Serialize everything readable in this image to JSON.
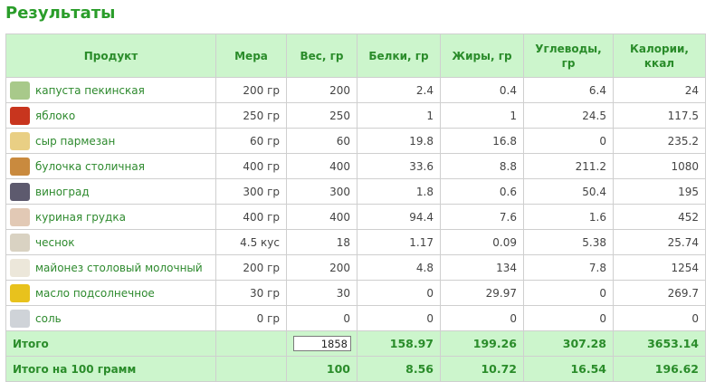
{
  "page_title": "Результаты",
  "columns": [
    "Продукт",
    "Мера",
    "Вес, гр",
    "Белки, гр",
    "Жиры, гр",
    "Углеводы, гр",
    "Калории, ккал"
  ],
  "products": [
    {
      "name": "капуста пекинская",
      "measure": "200 гр",
      "weight": "200",
      "protein": "2.4",
      "fat": "0.4",
      "carbs": "6.4",
      "kcal": "24",
      "icon": "cabbage-icon",
      "color": "#a8c98a"
    },
    {
      "name": "яблоко",
      "measure": "250 гр",
      "weight": "250",
      "protein": "1",
      "fat": "1",
      "carbs": "24.5",
      "kcal": "117.5",
      "icon": "apple-icon",
      "color": "#c8351e"
    },
    {
      "name": "сыр пармезан",
      "measure": "60 гр",
      "weight": "60",
      "protein": "19.8",
      "fat": "16.8",
      "carbs": "0",
      "kcal": "235.2",
      "icon": "cheese-icon",
      "color": "#e9cf84"
    },
    {
      "name": "булочка столичная",
      "measure": "400 гр",
      "weight": "400",
      "protein": "33.6",
      "fat": "8.8",
      "carbs": "211.2",
      "kcal": "1080",
      "icon": "bun-icon",
      "color": "#c98a3e"
    },
    {
      "name": "виноград",
      "measure": "300 гр",
      "weight": "300",
      "protein": "1.8",
      "fat": "0.6",
      "carbs": "50.4",
      "kcal": "195",
      "icon": "grapes-icon",
      "color": "#5d5a6e"
    },
    {
      "name": "куриная грудка",
      "measure": "400 гр",
      "weight": "400",
      "protein": "94.4",
      "fat": "7.6",
      "carbs": "1.6",
      "kcal": "452",
      "icon": "chicken-breast-icon",
      "color": "#e2c9b5"
    },
    {
      "name": "чеснок",
      "measure": "4.5 кус",
      "weight": "18",
      "protein": "1.17",
      "fat": "0.09",
      "carbs": "5.38",
      "kcal": "25.74",
      "icon": "garlic-icon",
      "color": "#d9d2c2"
    },
    {
      "name": "майонез столовый молочный",
      "measure": "200 гр",
      "weight": "200",
      "protein": "4.8",
      "fat": "134",
      "carbs": "7.8",
      "kcal": "1254",
      "icon": "mayonnaise-icon",
      "color": "#ece7da"
    },
    {
      "name": "масло подсолнечное",
      "measure": "30 гр",
      "weight": "30",
      "protein": "0",
      "fat": "29.97",
      "carbs": "0",
      "kcal": "269.7",
      "icon": "sunflower-oil-icon",
      "color": "#e8c21d"
    },
    {
      "name": "соль",
      "measure": "0 гр",
      "weight": "0",
      "protein": "0",
      "fat": "0",
      "carbs": "0",
      "kcal": "0",
      "icon": "salt-icon",
      "color": "#cfd3d8"
    }
  ],
  "total": {
    "label": "Итого",
    "weight": "1858",
    "protein": "158.97",
    "fat": "199.26",
    "carbs": "307.28",
    "kcal": "3653.14"
  },
  "per100": {
    "label": "Итого на 100 грамм",
    "weight": "100",
    "protein": "8.56",
    "fat": "10.72",
    "carbs": "16.54",
    "kcal": "196.62"
  },
  "colors": {
    "accent": "#2a9d2a",
    "header_bg": "#ccf5cc",
    "link": "#2e8a2e"
  }
}
